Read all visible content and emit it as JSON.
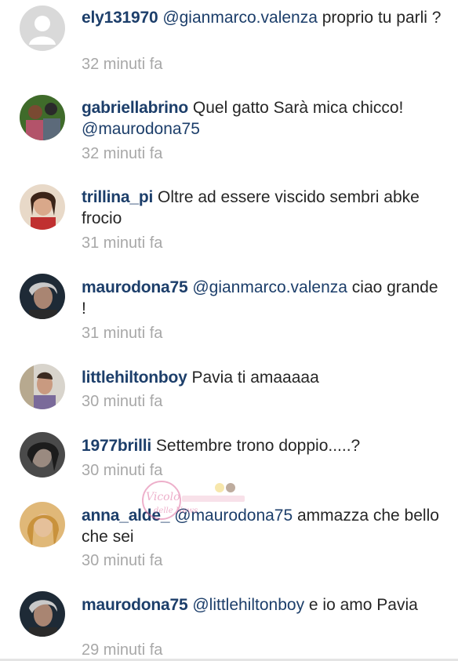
{
  "comments": [
    {
      "username": "ely131970",
      "mention": "@gianmarco.valenza",
      "text": " proprio tu parli ?",
      "time": "32 minuti fa",
      "avatar_icon": "default-user-icon"
    },
    {
      "username": "gabriellabrino",
      "mention": "",
      "text": "Quel gatto Sarà mica chicco!",
      "mention_after": "@maurodona75",
      "time": "32 minuti fa",
      "avatar_icon": "user-photo"
    },
    {
      "username": "trillina_pi",
      "mention": "",
      "text": "Oltre ad essere viscido sembri abke frocio",
      "time": "31 minuti fa",
      "avatar_icon": "user-photo"
    },
    {
      "username": "maurodona75",
      "mention": "@gianmarco.valenza",
      "text": " ciao grande !",
      "time": "31 minuti fa",
      "avatar_icon": "user-photo"
    },
    {
      "username": "littlehiltonboy",
      "mention": "",
      "text": "Pavia ti amaaaaa",
      "time": "30 minuti fa",
      "avatar_icon": "user-photo"
    },
    {
      "username": "1977brilli",
      "mention": "",
      "text": "Settembre trono doppio.....?",
      "time": "30 minuti fa",
      "avatar_icon": "user-photo"
    },
    {
      "username": "anna_alde_",
      "mention": "@maurodona75",
      "text": " ammazza che bello che sei",
      "time": "30 minuti fa",
      "avatar_icon": "user-photo"
    },
    {
      "username": "maurodona75",
      "mention": "@littlehiltonboy",
      "text": " e io amo Pavia",
      "time": "29 minuti fa",
      "avatar_icon": "user-photo"
    }
  ],
  "watermark": {
    "text": "Vicolo delle News"
  },
  "colors": {
    "username": "#1c3e6a",
    "text": "#262626",
    "timestamp": "#a8a8a8"
  }
}
